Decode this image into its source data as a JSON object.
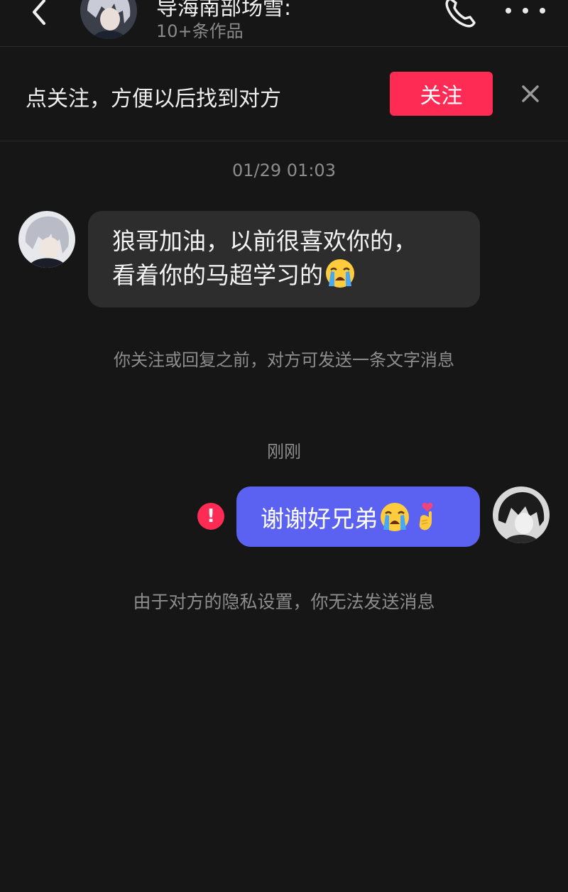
{
  "header": {
    "name": "导海南部场雪:",
    "subtitle": "10+条作品",
    "back_icon": "chevron-left-icon",
    "call_icon": "phone-icon",
    "more_icon": "more-dots-icon"
  },
  "follow_bar": {
    "text": "点关注，方便以后找到对方",
    "button_label": "关注",
    "close_icon": "close-icon"
  },
  "messages": [
    {
      "timestamp": "01/29 01:03"
    },
    {
      "side": "left",
      "lines": [
        "狼哥加油，以前很喜欢你的，",
        "看着你的马超学习的"
      ],
      "emoji": "loudly-crying-face"
    },
    {
      "system_notice": "你关注或回复之前，对方可发送一条文字消息"
    },
    {
      "timestamp": "刚刚"
    },
    {
      "side": "right",
      "text": "谢谢好兄弟",
      "emoji": [
        "loudly-crying-face",
        "hand-heart"
      ],
      "status": "send-failed"
    },
    {
      "system_notice": "由于对方的隐私设置，你无法发送消息"
    }
  ],
  "colors": {
    "background": "#161616",
    "accent": "#fe2c55",
    "outgoing_bubble": "#5b62f2",
    "incoming_bubble": "#2d2d2d",
    "muted_text": "#8d8d8d"
  }
}
